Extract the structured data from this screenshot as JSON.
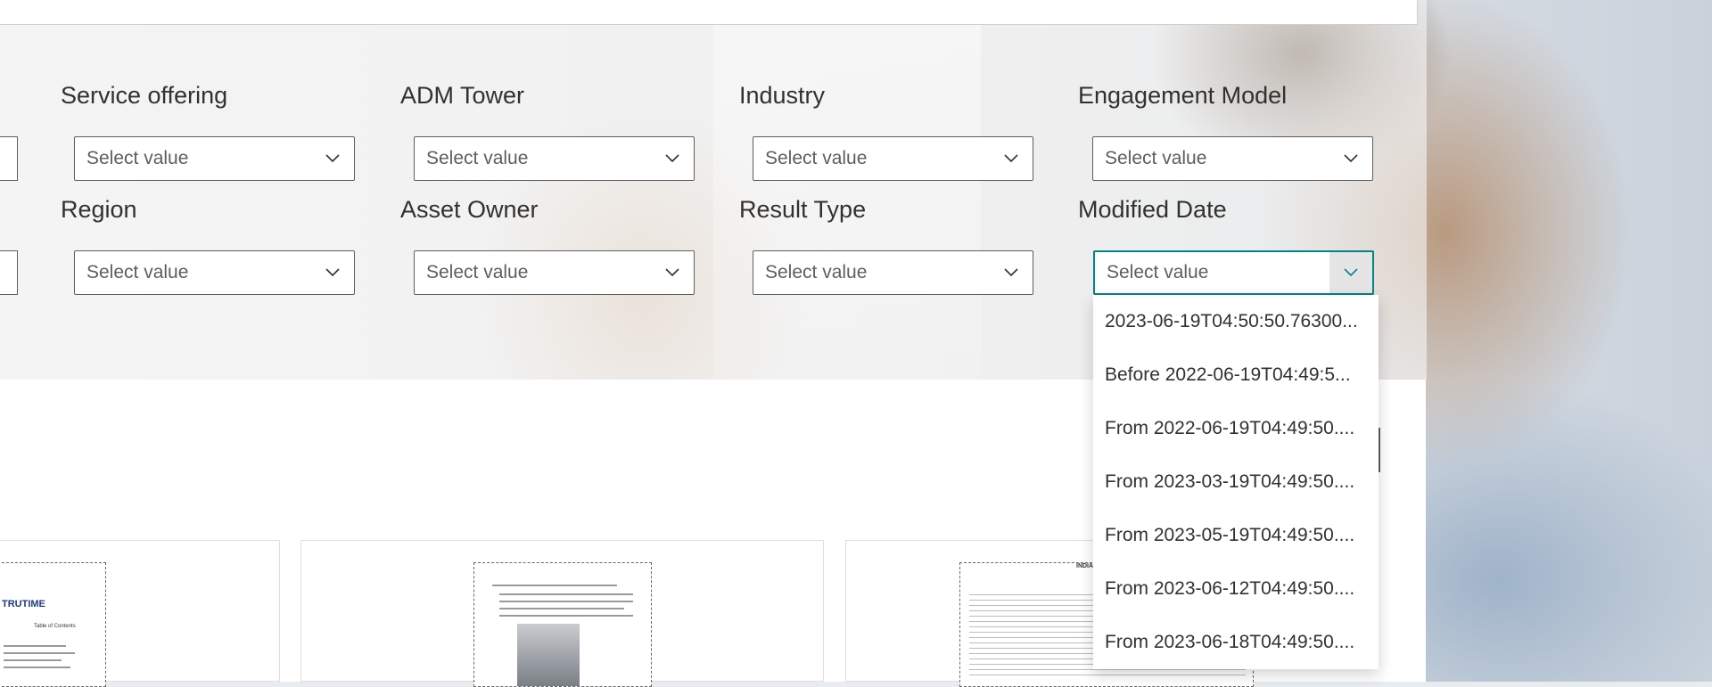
{
  "filters": {
    "row1": [
      {
        "label": "Service offering",
        "placeholder": "Select value"
      },
      {
        "label": "ADM Tower",
        "placeholder": "Select value"
      },
      {
        "label": "Industry",
        "placeholder": "Select value"
      },
      {
        "label": "Engagement Model",
        "placeholder": "Select value"
      }
    ],
    "row2": [
      {
        "label": "Region",
        "placeholder": "Select value"
      },
      {
        "label": "Asset Owner",
        "placeholder": "Select value"
      },
      {
        "label": "Result Type",
        "placeholder": "Select value"
      },
      {
        "label": "Modified Date",
        "placeholder": "Select value"
      }
    ]
  },
  "modified_date_dropdown": {
    "options": [
      "2023-06-19T04:50:50.76300...",
      "Before 2022-06-19T04:49:5...",
      "From 2022-06-19T04:49:50....",
      "From 2023-03-19T04:49:50....",
      "From 2023-05-19T04:49:50....",
      "From 2023-06-12T04:49:50....",
      "From 2023-06-18T04:49:50...."
    ]
  },
  "cards": [
    {
      "thumb_heading": "TRUTIME",
      "thumb_subheading": "Table of Contents"
    },
    {
      "thumb_heading": ""
    },
    {
      "thumb_heading": "INDIA H"
    }
  ],
  "colors": {
    "focus_border": "#038387",
    "text": "#323130",
    "placeholder": "#605e5c"
  }
}
